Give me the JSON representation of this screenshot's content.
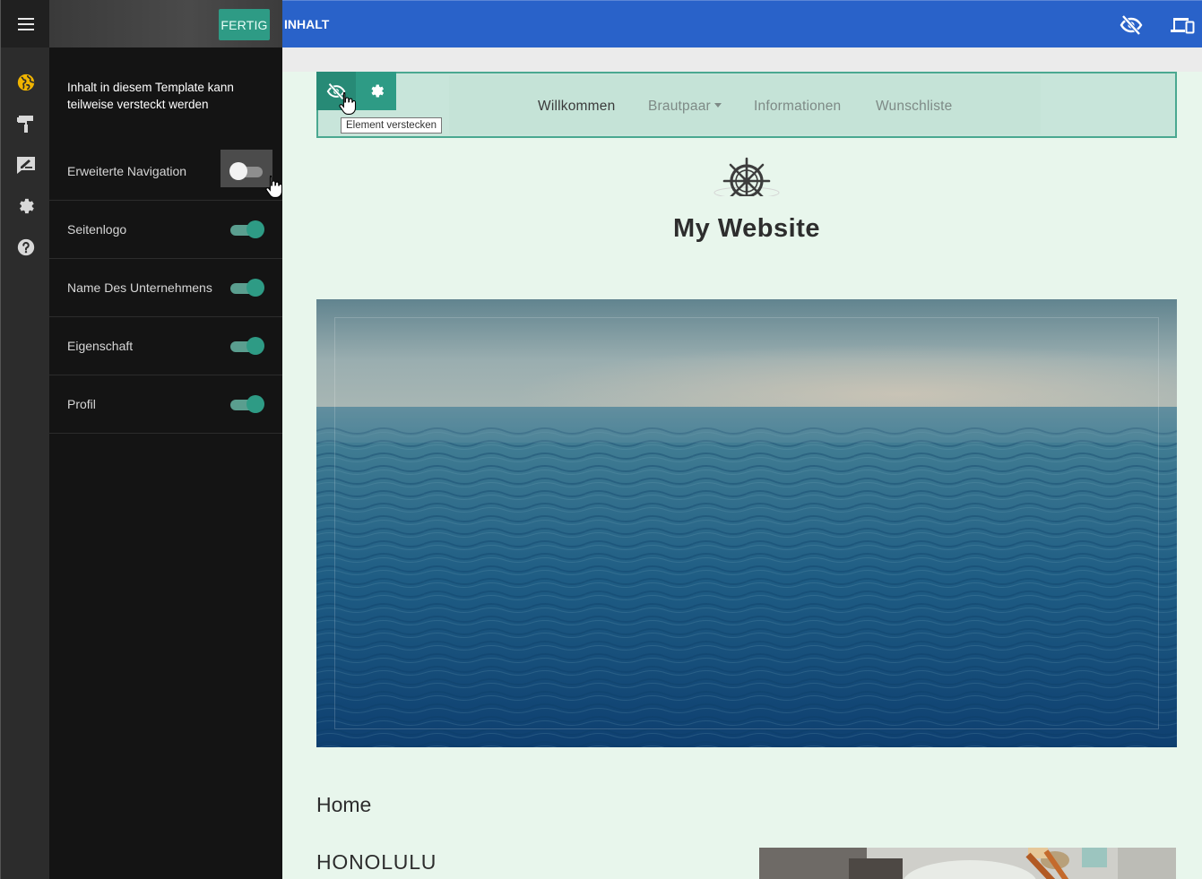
{
  "rail": {
    "menu_icon": "hamburger-icon",
    "items": [
      {
        "icon": "globe-icon",
        "active": true,
        "color": "#f0b400"
      },
      {
        "icon": "paint-roller-icon",
        "active": false
      },
      {
        "icon": "edit-sign-icon",
        "active": false
      },
      {
        "icon": "gear-icon",
        "active": false
      },
      {
        "icon": "help-icon",
        "active": false
      }
    ]
  },
  "panel": {
    "done_label": "FERTIG",
    "note": "Inhalt in diesem Template kann teilweise versteckt werden",
    "options": [
      {
        "label": "Erweiterte Navigation",
        "enabled": false
      },
      {
        "label": "Seitenlogo",
        "enabled": true
      },
      {
        "label": "Name Des Unternehmens",
        "enabled": true
      },
      {
        "label": "Eigenschaft",
        "enabled": true
      },
      {
        "label": "Profil",
        "enabled": true
      }
    ]
  },
  "topbar": {
    "title": "INHALT",
    "hide_icon": "eye-off-icon",
    "device_icon": "devices-icon"
  },
  "editor": {
    "tooltip": "Element verstecken",
    "toolbar_icons": [
      "eye-off-icon",
      "gear-icon"
    ]
  },
  "site": {
    "nav": [
      "Willkommen",
      "Brautpaar",
      "Informationen",
      "Wunschliste"
    ],
    "logo_icon": "ship-wheel-icon",
    "title": "My Website",
    "home_heading": "Home",
    "section_heading": "HONOLULU"
  },
  "colors": {
    "accent": "#2e9b85",
    "topbar": "#2962c9",
    "canvas": "#e8f6ec",
    "rail_active": "#f0b400"
  }
}
